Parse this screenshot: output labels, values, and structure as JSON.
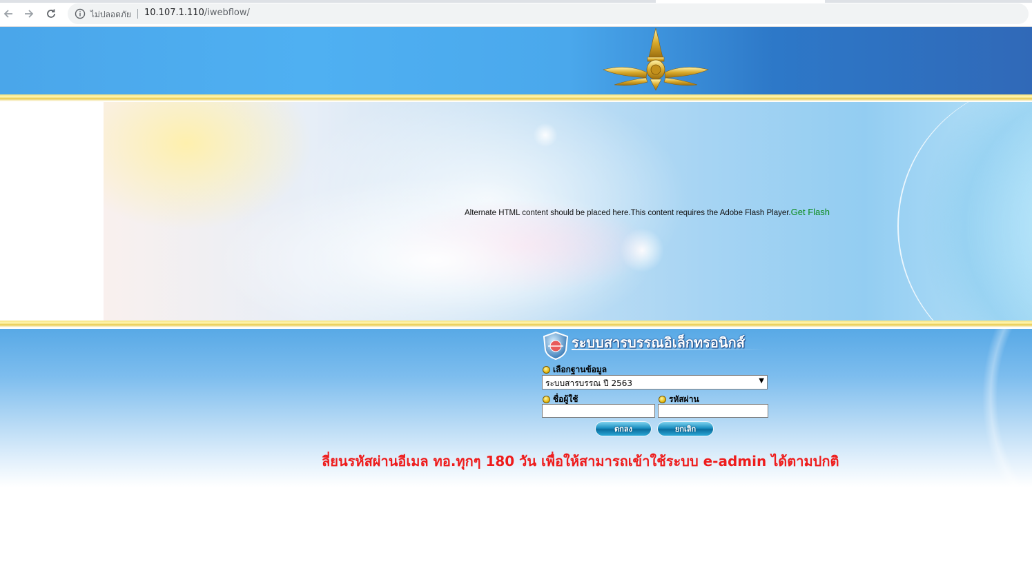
{
  "browser": {
    "security_label": "ไม่ปลอดภัย",
    "url_host": "10.107.1.110",
    "url_path": "/iwebflow/"
  },
  "flash": {
    "message": "Alternate HTML content should be placed here.This content requires the Adobe Flash Player.",
    "link_label": "Get Flash",
    "link_color": "#0a8a1a"
  },
  "login": {
    "system_title": "ระบบสารบรรณอิเล็กทรอนิกส์",
    "database_label": "เลือกฐานข้อมูล",
    "database_selected": "ระบบสารบรรณ ปี 2563",
    "username_label": "ชื่อผู้ใช้",
    "password_label": "รหัสผ่าน",
    "username_value": "",
    "password_value": "",
    "ok_button": "ตกลง",
    "cancel_button": "ยกเลิก"
  },
  "notice": {
    "text": "ลี่ยนรหัสผ่านอีเมล ทอ.ทุกๆ 180 วัน เพื่อให้สามารถเข้าใช้ระบบ e-admin ได้ตามปกติ",
    "color": "#ee1c1c"
  }
}
